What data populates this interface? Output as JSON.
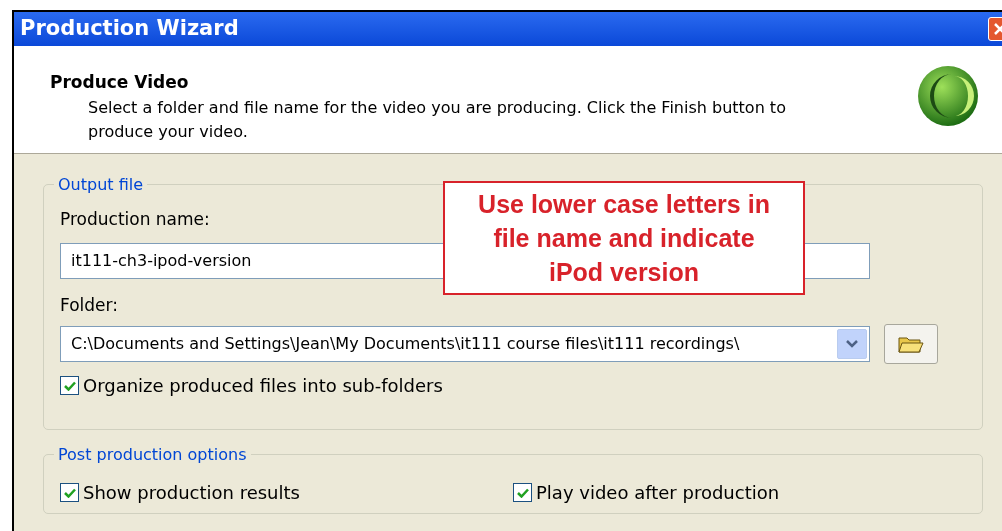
{
  "window": {
    "title": "Production Wizard"
  },
  "header": {
    "title": "Produce Video",
    "description": "Select a folder and file name for the video you are producing.  Click the Finish button to produce your video."
  },
  "output_file": {
    "legend": "Output file",
    "name_label": "Production name:",
    "name_value": "it111-ch3-ipod-version",
    "folder_label": "Folder:",
    "folder_value": "C:\\Documents and Settings\\Jean\\My Documents\\it111 course files\\it111 recordings\\",
    "options": [
      {
        "label": "Organize produced files into sub-folders",
        "checked": true
      }
    ]
  },
  "callout": {
    "text": "Use lower case letters in file name and indicate iPod version"
  },
  "post_production": {
    "legend": "Post production options",
    "options": [
      {
        "label": "Show production results",
        "checked": true
      },
      {
        "label": "Play video after production",
        "checked": true
      }
    ]
  }
}
